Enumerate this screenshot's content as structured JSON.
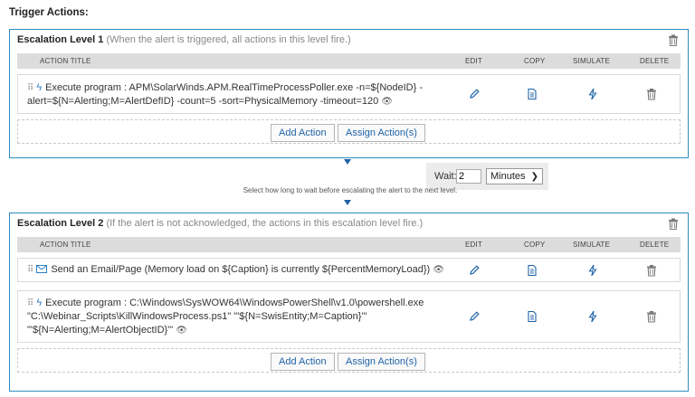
{
  "section_title": "Trigger Actions:",
  "columns": {
    "action_title": "ACTION TITLE",
    "edit": "EDIT",
    "copy": "COPY",
    "simulate": "SIMULATE",
    "delete": "DELETE"
  },
  "levels": [
    {
      "name": "Escalation Level 1",
      "description": "(When the alert is triggered, all actions in this level fire.)",
      "actions": [
        {
          "icon": "lightning-icon",
          "line1": "Execute program : APM\\SolarWinds.APM.RealTimeProcessPoller.exe -n=${NodeID} -",
          "line2": "alert=${N=Alerting;M=AlertDefID} -count=5 -sort=PhysicalMemory -timeout=120"
        }
      ],
      "add_action": "Add Action",
      "assign_action": "Assign Action(s)"
    },
    {
      "name": "Escalation Level 2",
      "description": "(If the alert is not acknowledged, the actions in this escalation level fire.)",
      "actions": [
        {
          "icon": "envelope-icon",
          "line1": "Send an Email/Page (Memory load on ${Caption} is currently ${PercentMemoryLoad})"
        },
        {
          "icon": "lightning-icon",
          "line1": "Execute program : C:\\Windows\\SysWOW64\\WindowsPowerShell\\v1.0\\powershell.exe",
          "line2": "\"C:\\Webinar_Scripts\\KillWindowsProcess.ps1\" \"'${N=SwisEntity;M=Caption}'\"",
          "line3": "\"'${N=Alerting;M=AlertObjectID}'\""
        }
      ],
      "add_action": "Add Action",
      "assign_action": "Assign Action(s)"
    }
  ],
  "wait": {
    "label": "Wait:",
    "value": "2",
    "unit": "Minutes",
    "hint": "Select how long to wait before escalating the alert to the next level."
  },
  "colors": {
    "accent": "#2e8bc0",
    "link": "#1f63a6",
    "header_bg": "#dcdcdc"
  }
}
